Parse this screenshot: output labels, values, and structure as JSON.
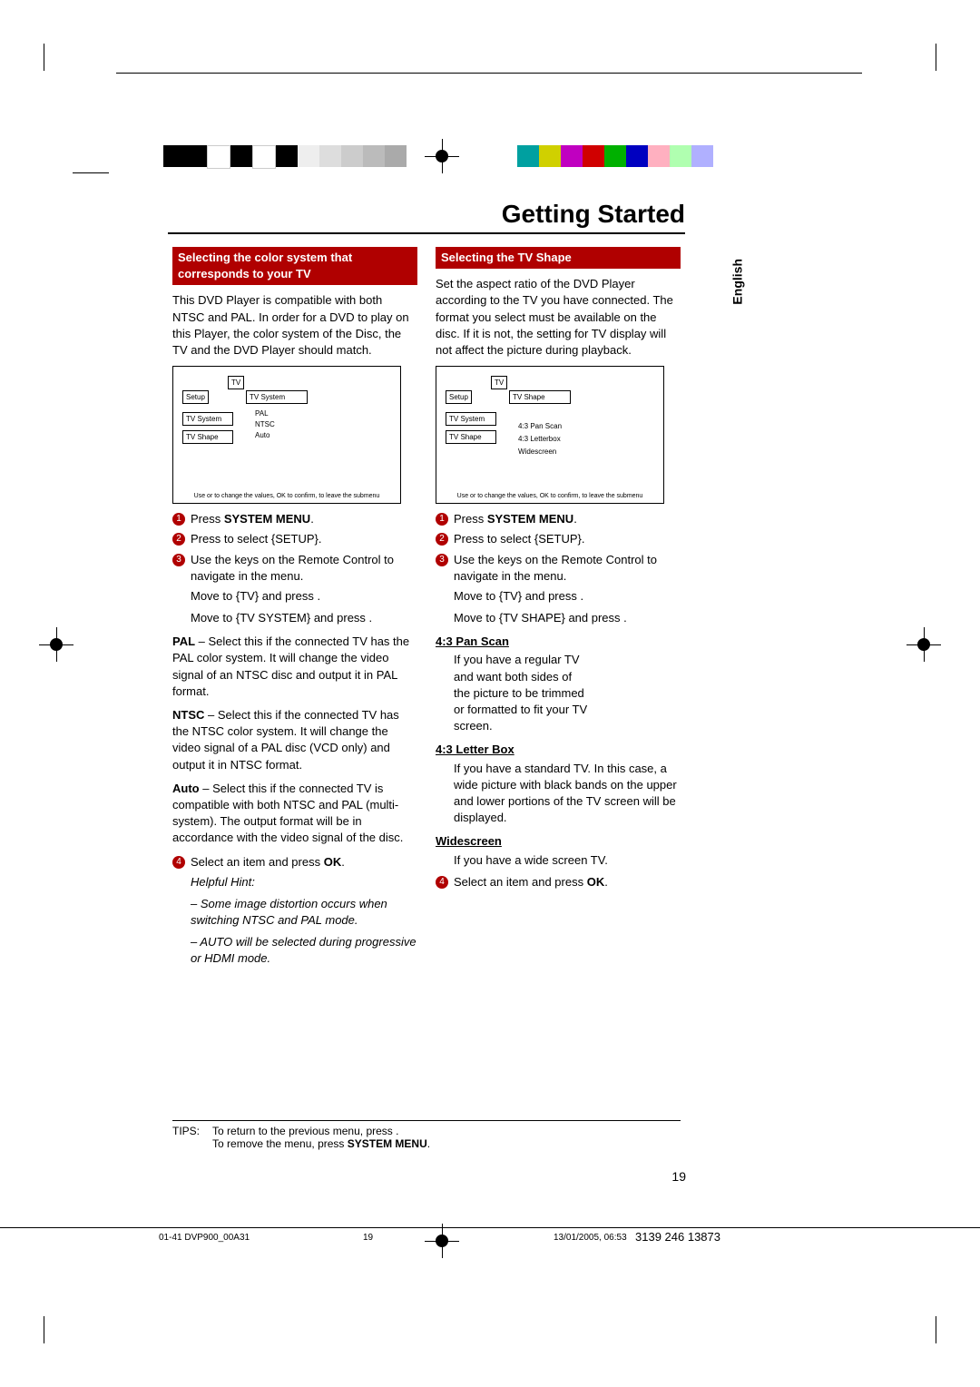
{
  "title": "Getting Started",
  "sidelang": "English",
  "left": {
    "header": "Selecting the color system that corresponds to your TV",
    "intro": "This DVD Player is compatible with both NTSC and PAL. In order for a DVD to play on this Player, the color system of the Disc, the TV and the DVD Player should match.",
    "menu": {
      "tv_label": "TV",
      "setup": "Setup",
      "tvsystem": "TV System",
      "tvshape": "TV Shape",
      "panel_title": "TV System",
      "opt1": "PAL",
      "opt2": "NTSC",
      "opt3": "Auto",
      "footer": "Use    or    to change the values, OK to confirm, to leave the submenu"
    },
    "step1_pre": "Press ",
    "step1_bold": "SYSTEM MENU",
    "step1_post": ".",
    "step2": "Press     to select {SETUP}.",
    "step3a": "Use the             keys on the Remote Control to navigate in the menu.",
    "step3b1": "Move to {TV} and press    .",
    "step3b2": "Move to {TV SYSTEM} and press    .",
    "pal_label": "PAL",
    "pal_text": " – Select this if the connected TV has the PAL color system. It will change the video signal of an NTSC disc and output it in PAL format.",
    "ntsc_label": "NTSC",
    "ntsc_text": " – Select this if the connected TV has the NTSC color system. It will change the video signal of a PAL disc (VCD only) and output it in NTSC format.",
    "auto_label": "Auto",
    "auto_text": " – Select this if the connected TV is compatible with both NTSC and PAL (multi-system). The output format will be in accordance with the video signal of the disc.",
    "step4_pre": "Select an item and press ",
    "step4_bold": "OK",
    "step4_post": ".",
    "hint_title": "Helpful Hint:",
    "hint1": "– Some image distortion occurs when switching NTSC and PAL mode.",
    "hint2": "– AUTO will be selected during progressive or HDMI mode."
  },
  "right": {
    "header": "Selecting the TV Shape",
    "intro": "Set the aspect ratio of the DVD Player according to the TV you have connected. The format you select must be available on the disc. If it is not, the setting for TV display will not affect the picture during playback.",
    "menu": {
      "tv_label": "TV",
      "setup": "Setup",
      "tvsystem": "TV System",
      "tvshape": "TV Shape",
      "panel_title": "TV Shape",
      "opt1": "4:3 Pan Scan",
      "opt2": "4:3 Letterbox",
      "opt3": "Widescreen",
      "footer": "Use    or    to change the values, OK to confirm, to leave the submenu"
    },
    "step1_pre": "Press ",
    "step1_bold": "SYSTEM MENU",
    "step1_post": ".",
    "step2": "Press     to select {SETUP}.",
    "step3a": "Use the             keys on the Remote Control to navigate in the menu.",
    "step3b1": "Move to {TV} and press    .",
    "step3b2": "Move to {TV SHAPE} and press    .",
    "panscan_title": "4:3 Pan Scan",
    "panscan_text": "If you have a regular TV and want both sides of the picture to be trimmed or formatted to fit your TV screen.",
    "letterbox_title": "4:3 Letter Box",
    "letterbox_text": "If you have a standard TV. In this case, a wide picture with black bands on the upper and lower portions of the TV screen will be displayed.",
    "widescreen_title": "Widescreen",
    "widescreen_text": "If you have a wide screen TV.",
    "step4_pre": "Select an item and press ",
    "step4_bold": "OK",
    "step4_post": "."
  },
  "tips_label": "TIPS:",
  "tips_line1": "To return to the previous menu, press    .",
  "tips_line2_pre": "To remove the menu, press ",
  "tips_line2_bold": "SYSTEM MENU",
  "tips_line2_post": ".",
  "pagenum": "19",
  "footer_left": "01-41 DVP900_00A31",
  "footer_center": "19",
  "footer_right1": "13/01/2005, 06:53",
  "footer_right2": "3139 246 13873",
  "colorbar_left": [
    "#000",
    "#000",
    "#fff",
    "#000",
    "#fff",
    "#000",
    "#eee",
    "#ddd",
    "#ccc",
    "#bbb",
    "#aaa"
  ],
  "colorbar_right": [
    "#00a0a0",
    "#d0d000",
    "#c000c0",
    "#d00000",
    "#00b000",
    "#0000c0",
    "#ffb0c0",
    "#b0ffb0",
    "#b0b0ff"
  ]
}
